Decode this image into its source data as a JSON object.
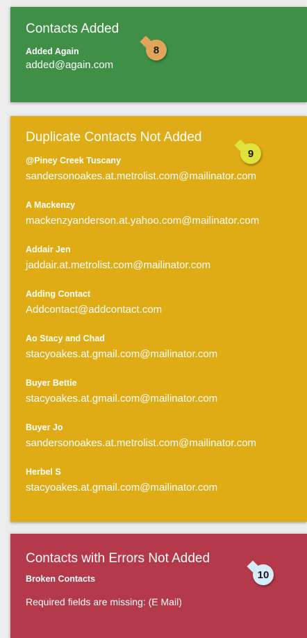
{
  "colors": {
    "added_bg": "#3f8f47",
    "duplicate_bg": "#e0ac15",
    "errors_bg": "#b43a4b",
    "badge_added": "#e0a45a",
    "badge_duplicate": "#dfe23a",
    "badge_errors": "#d7ecfb"
  },
  "added": {
    "title": "Contacts Added",
    "badge": "8",
    "contacts": [
      {
        "name": "Added Again",
        "email": "added@again.com"
      }
    ]
  },
  "duplicates": {
    "title": "Duplicate Contacts Not Added",
    "badge": "9",
    "contacts": [
      {
        "name": "@Piney Creek Tuscany",
        "email": "sandersonoakes.at.metrolist.com@mailinator.com"
      },
      {
        "name": "A Mackenzy",
        "email": "mackenzyanderson.at.yahoo.com@mailinator.com"
      },
      {
        "name": "Addair Jen",
        "email": "jaddair.at.metrolist.com@mailinator.com"
      },
      {
        "name": "Adding Contact",
        "email": "Addcontact@addcontact.com"
      },
      {
        "name": "Ao Stacy and Chad",
        "email": "stacyoakes.at.gmail.com@mailinator.com"
      },
      {
        "name": "Buyer Bettie",
        "email": "stacyoakes.at.gmail.com@mailinator.com"
      },
      {
        "name": "Buyer Jo",
        "email": "sandersonoakes.at.metrolist.com@mailinator.com"
      },
      {
        "name": "Herbel S",
        "email": "stacyoakes.at.gmail.com@mailinator.com"
      }
    ]
  },
  "errors": {
    "title": "Contacts with Errors Not Added",
    "badge": "10",
    "contacts": [
      {
        "name": "Broken  Contacts",
        "message": "Required fields are missing: (E Mail)"
      }
    ]
  }
}
